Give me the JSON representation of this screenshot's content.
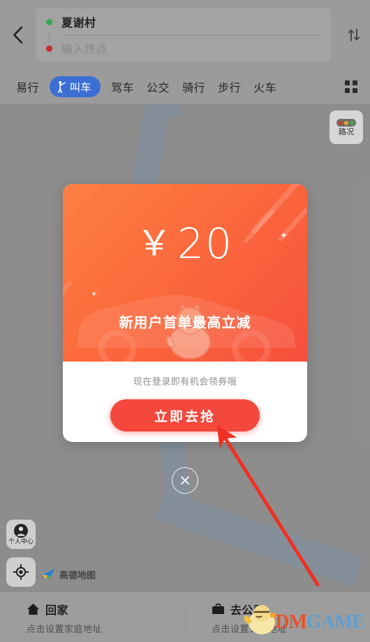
{
  "header": {
    "back_icon": "chevron-left-icon",
    "swap_icon": "swap-vertical-icon",
    "start_point": "夏谢村",
    "end_point_placeholder": "输入终点",
    "start_dot_color": "#34a853",
    "end_dot_color": "#cc2b2b"
  },
  "tabs": {
    "items": [
      {
        "label": "易行",
        "active": false
      },
      {
        "label": "叫车",
        "active": true,
        "icon": "hail-ride-icon"
      },
      {
        "label": "驾车",
        "active": false
      },
      {
        "label": "公交",
        "active": false
      },
      {
        "label": "骑行",
        "active": false
      },
      {
        "label": "步行",
        "active": false
      },
      {
        "label": "火车",
        "active": false
      }
    ],
    "more_icon": "grid-icon",
    "active_color": "#3b6fd4"
  },
  "map": {
    "traffic_button": {
      "label": "路况",
      "icon": "traffic-light-icon"
    },
    "traffic_lights": [
      "#cc3b2b",
      "#e3a52b",
      "#3fa84f"
    ],
    "user_center_button": {
      "label": "个人中心",
      "icon": "user-avatar-icon"
    },
    "locate_button": {
      "icon": "crosshair-locate-icon"
    },
    "brand": {
      "name": "高德地图",
      "icon": "amap-logo-icon"
    },
    "river_color": "#8ea3b8",
    "base_color": "#a0a09f"
  },
  "promo": {
    "currency_symbol": "￥",
    "amount": "20",
    "headline": "新用户首单最高立减",
    "tip": "现在登录即有机会领券哦",
    "cta_label": "立即去抢",
    "cta_color": "#f4483d",
    "hero_gradient_from": "#fd8042",
    "hero_gradient_to": "#f6503d",
    "close_icon": "close-circle-icon"
  },
  "annotation": {
    "arrow_color": "#ee3124",
    "arrow_from": "(455,835)",
    "arrow_to": "(312,612)"
  },
  "shortcuts": [
    {
      "title": "回家",
      "subtitle": "点击设置家庭地址",
      "icon": "home-icon"
    },
    {
      "title": "去公司",
      "subtitle": "点击设置公司地址",
      "icon": "briefcase-icon"
    }
  ],
  "watermark": {
    "text_primary": "3DM",
    "text_secondary": "GAME",
    "primary_color": "#e8502a",
    "secondary_color": "#5f9fd0",
    "mascot_icon": "chick-mascot-icon"
  }
}
